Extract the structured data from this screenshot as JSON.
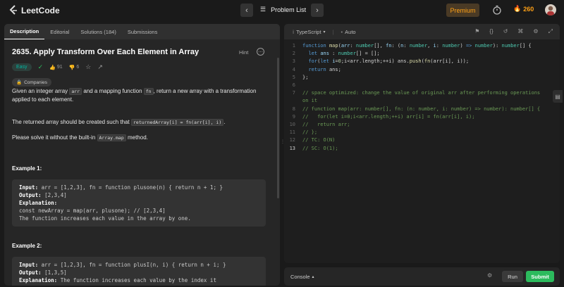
{
  "header": {
    "logo_text": "LeetCode",
    "problem_list": "Problem List",
    "premium": "Premium",
    "streak": "260"
  },
  "tabs": [
    {
      "label": "Description"
    },
    {
      "label": "Editorial"
    },
    {
      "label": "Solutions (184)"
    },
    {
      "label": "Submissions"
    }
  ],
  "problem": {
    "title": "2635. Apply Transform Over Each Element in Array",
    "hint": "Hint",
    "difficulty": "Easy",
    "likes": "91",
    "dislikes": "6",
    "companies": "Companies",
    "para1_a": "Given an integer array ",
    "para1_code1": "arr",
    "para1_b": " and a mapping function ",
    "para1_code2": "fn",
    "para1_c": ", return a new array with a transformation applied to each element.",
    "para2_a": "The returned array should be created such that ",
    "para2_code": "returnedArray[i] = fn(arr[i], i)",
    "para2_b": ".",
    "para3_a": "Please solve it without the built-in ",
    "para3_code": "Array.map",
    "para3_b": " method."
  },
  "examples": [
    {
      "title": "Example 1:",
      "input_label": "Input:",
      "input": " arr = [1,2,3], fn = function plusone(n) { return n + 1; }",
      "output_label": "Output:",
      "output": " [2,3,4]",
      "explanation_label": "Explanation:",
      "exp1": "const newArray = map(arr, plusone); // [2,3,4]",
      "exp2": "The function increases each value in the array by one."
    },
    {
      "title": "Example 2:",
      "input_label": "Input:",
      "input": " arr = [1,2,3], fn = function plusI(n, i) { return n + i; }",
      "output_label": "Output:",
      "output": " [1,3,5]",
      "explanation_label": "Explanation:",
      "exp1": " The function increases each value by the index it"
    }
  ],
  "editor": {
    "language": "TypeScript",
    "auto": "Auto",
    "line_numbers": [
      "1",
      "2",
      "3",
      "4",
      "5",
      "6",
      "7",
      "",
      "8",
      "9",
      "10",
      "11",
      "12",
      "13"
    ]
  },
  "console": {
    "label": "Console",
    "run": "Run",
    "submit": "Submit"
  },
  "colors": {
    "accent": "#ffa116",
    "easy": "#00b8a3",
    "submit": "#2cbb5d"
  }
}
